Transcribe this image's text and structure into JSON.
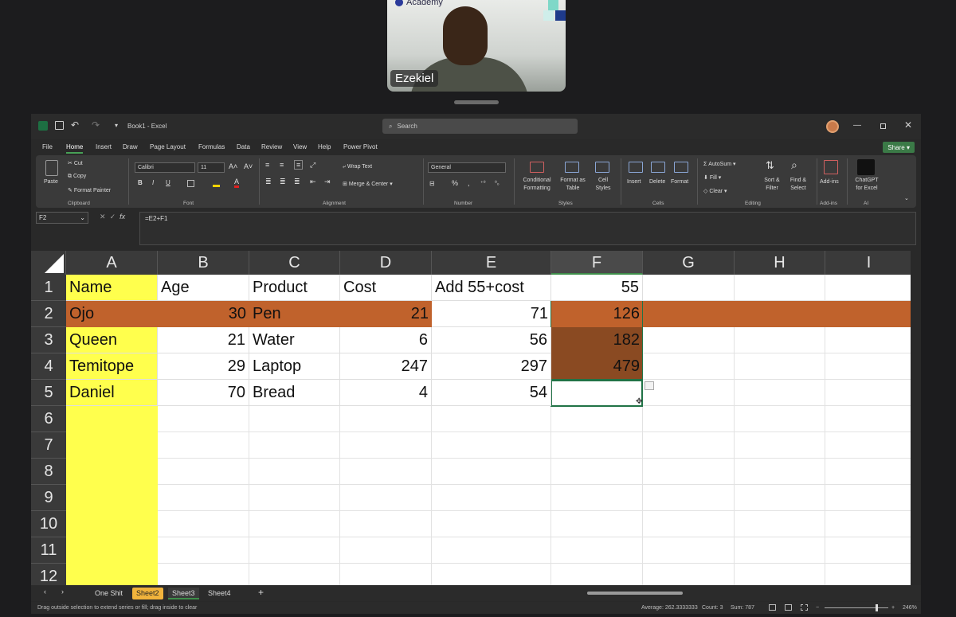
{
  "meeting": {
    "participant_name": "Ezekiel",
    "logo_text": "Academy"
  },
  "titlebar": {
    "doc_name": "Book1",
    "app_name": "Excel",
    "search_placeholder": "Search"
  },
  "menu": [
    "File",
    "Home",
    "Insert",
    "Draw",
    "Page Layout",
    "Formulas",
    "Data",
    "Review",
    "View",
    "Help",
    "Power Pivot"
  ],
  "active_menu": "Home",
  "share_label": "Share",
  "ribbon": {
    "clipboard": {
      "paste": "Paste",
      "cut": "Cut",
      "copy": "Copy",
      "format_painter": "Format Painter",
      "label": "Clipboard"
    },
    "font": {
      "family": "Calibri",
      "size": "11",
      "label": "Font",
      "bold": "B",
      "italic": "I",
      "underline": "U"
    },
    "alignment": {
      "wrap": "Wrap Text",
      "merge": "Merge & Center",
      "label": "Alignment"
    },
    "number": {
      "format": "General",
      "label": "Number"
    },
    "styles": {
      "conditional": "Conditional Formatting",
      "format_table": "Format as Table",
      "cell_styles": "Cell Styles",
      "label": "Styles"
    },
    "cells": {
      "insert": "Insert",
      "delete": "Delete",
      "format": "Format",
      "label": "Cells"
    },
    "editing": {
      "autosum": "AutoSum",
      "fill": "Fill",
      "clear": "Clear",
      "sort": "Sort & Filter",
      "find": "Find & Select",
      "label": "Editing"
    },
    "addins": {
      "addins": "Add-ins",
      "label": "Add-ins"
    },
    "ai": {
      "chatgpt": "ChatGPT for Excel",
      "label": "AI"
    }
  },
  "formula_bar": {
    "name_box": "F2",
    "formula": "=E2+F1"
  },
  "columns": [
    "A",
    "B",
    "C",
    "D",
    "E",
    "F",
    "G",
    "H",
    "I"
  ],
  "selected_column": "F",
  "rows": [
    "1",
    "2",
    "3",
    "4",
    "5",
    "6",
    "7",
    "8",
    "9",
    "10",
    "11",
    "12"
  ],
  "cells": {
    "r1": [
      "Name",
      "Age",
      "Product",
      "Cost",
      "Add 55+cost",
      "55"
    ],
    "r2": [
      "Ojo",
      "30",
      "Pen",
      "21",
      "71",
      "126"
    ],
    "r3": [
      "Queen",
      "21",
      "Water",
      "6",
      "56",
      "182"
    ],
    "r4": [
      "Temitope",
      "29",
      "Laptop",
      "247",
      "297",
      "479"
    ],
    "r5": [
      "Daniel",
      "70",
      "Bread",
      "4",
      "54",
      ""
    ]
  },
  "colors": {
    "name_column_fill": "#ffff4d",
    "highlight_row_fill": "#c0622c",
    "selection_fill": "#8a4a22",
    "selection_border": "#217346"
  },
  "sheet_tabs": [
    "One Shit",
    "Sheet2",
    "Sheet3",
    "Sheet4"
  ],
  "active_sheet": "Sheet2",
  "status": {
    "message": "Drag outside selection to extend series or fill; drag inside to clear",
    "average": "Average: 262.3333333",
    "count": "Count: 3",
    "sum": "Sum: 787",
    "zoom": "246%"
  }
}
